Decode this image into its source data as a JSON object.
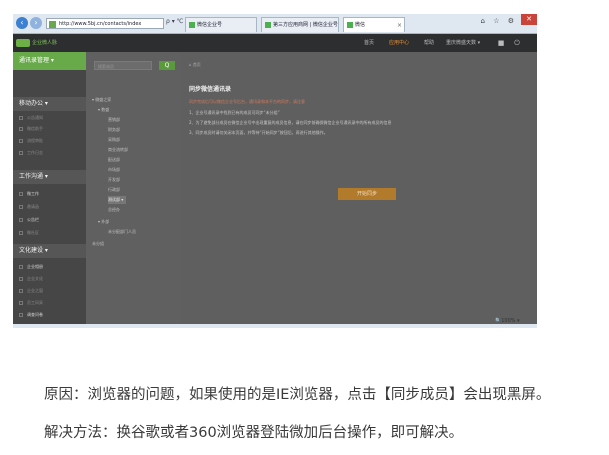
{
  "browser": {
    "address": "http://www.5bj.cn/contacts/index",
    "controls": "ρ ▾ ℃ ×",
    "tabs": [
      {
        "label": "微信企业号"
      },
      {
        "label": "第三方应用商网 | 微信企业号"
      },
      {
        "label": "微信"
      }
    ],
    "right_icons": "⌂ ☆ ⚙",
    "close": "✕",
    "zoom": "🔍100%  ▾"
  },
  "app": {
    "logo_text": "企业微人脉",
    "nav": [
      {
        "label": "首页"
      },
      {
        "label": "应用中心"
      },
      {
        "label": "帮助"
      },
      {
        "label": "重庆微盛天数 ▾"
      }
    ]
  },
  "sidebar": {
    "title": "通讯录管理 ▾",
    "sections": [
      {
        "label": "移动办公 ▾",
        "items": [
          "公告通知",
          "微信助手",
          "流程审批",
          "工作日志"
        ]
      },
      {
        "label": "工作沟通 ▾",
        "items": [
          "微工作",
          "邀请函",
          "公告栏",
          "微社区"
        ]
      },
      {
        "label": "文化建设 ▾",
        "items": [
          "企业相册",
          "企业文化",
          "企业之窗",
          "员工风采",
          "调查问卷"
        ]
      }
    ]
  },
  "tree": {
    "search_placeholder": "搜索成员",
    "search_button": "Q",
    "nodes": [
      "▾ 微盛之家",
      "▾ 数盛",
      "营销部",
      "财务部",
      "采购部",
      "商业流转部",
      "配送部",
      "市场部",
      "开发部",
      "行政部",
      "测试部 ▾",
      "总经办",
      "▾ 外部",
      "未分配部门人员",
      "未分组"
    ]
  },
  "content": {
    "breadcrumb": "首页",
    "title": "同步微信通讯录",
    "warning": "同步完成后可以微信企业号后台，通讯录和本平台的同步，请注意",
    "steps": [
      "1、企业号通讯录中找到已有的成员可同步“未分组”",
      "2、为了避免部分成员在微信企业号中出现重复的成员信息，请在同步前确保微信企业号通讯录中的所有成员的信息",
      "3、同步成员时请勿关闭本页面，并等待“开始同步”按钮后，再进行其他操作。"
    ],
    "sync_button": "开始同步"
  },
  "article": {
    "reason": "原因：浏览器的问题，如果使用的是IE浏览器，点击【同步成员】会出现黑屏。",
    "solution": "解决方法：换谷歌或者360浏览器登陆微加后台操作，即可解决。"
  }
}
